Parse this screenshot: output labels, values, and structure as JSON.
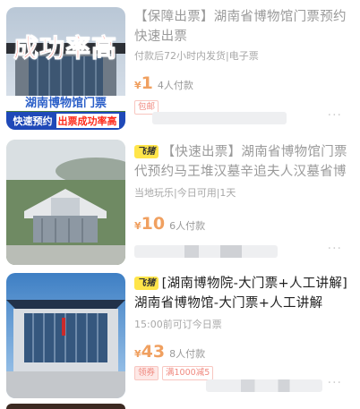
{
  "items": [
    {
      "image_caption": "成功率高",
      "image_label_1": "湖南博物馆门票",
      "image_label_2": "快速预约",
      "image_label_3": "出票成功率高",
      "title": "【保障出票】湖南省博物馆门票预约快速出票",
      "subtitle": "付款后72小时内发货|电子票",
      "currency": "¥",
      "price": "1",
      "paid_count": "4人付款",
      "tags": [
        "包邮"
      ],
      "more": "..."
    },
    {
      "badge": "飞猪",
      "title": "【快速出票】湖南省博物馆门票代预约马王堆汉墓辛追夫人汉墓省博",
      "subtitle": "当地玩乐|今日可用|1天",
      "currency": "¥",
      "price": "10",
      "paid_count": "6人付款",
      "more": "..."
    },
    {
      "badge": "飞猪",
      "title": "[湖南博物院-大门票+人工讲解]湖南省博物馆-大门票+人工讲解",
      "subtitle": "15:00前可订今日票",
      "currency": "¥",
      "price": "43",
      "paid_count": "8人付款",
      "tags": [
        "领券",
        "满1000减5"
      ],
      "more": "..."
    }
  ],
  "colors": {
    "price": "#f0a060",
    "badge": "#ffe54a",
    "tag": "#f08a80"
  }
}
